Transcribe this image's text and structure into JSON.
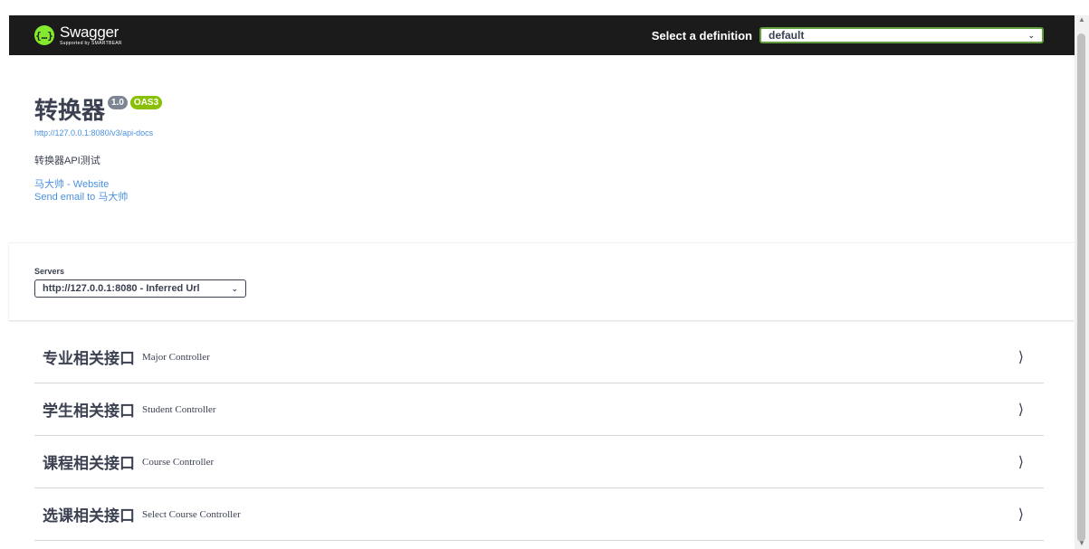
{
  "header": {
    "logo_icon": "{…}",
    "logo_title": "Swagger",
    "logo_subtitle": "Supported by SMARTBEAR",
    "definition_label": "Select a definition",
    "definition_value": "default"
  },
  "info": {
    "title": "转换器",
    "version": "1.0",
    "oas": "OAS3",
    "url": "http://127.0.0.1:8080/v3/api-docs",
    "description": "转换器API测试",
    "website_link": "马大帅 - Website",
    "email_link": "Send email to 马大帅"
  },
  "servers": {
    "label": "Servers",
    "selected": "http://127.0.0.1:8080 - Inferred Url"
  },
  "tags": [
    {
      "name": "专业相关接口",
      "desc": "Major Controller"
    },
    {
      "name": "学生相关接口",
      "desc": "Student Controller"
    },
    {
      "name": "课程相关接口",
      "desc": "Course Controller"
    },
    {
      "name": "选课相关接口",
      "desc": "Select Course Controller"
    }
  ],
  "icons": {
    "chevron": "chevron-down-icon",
    "arrow": "chevron-right-icon"
  },
  "colors": {
    "topbar": "#1b1b1b",
    "accent": "#85ea2d",
    "link": "#4990e2",
    "oas_badge": "#89bf04",
    "version_badge": "#7d8492"
  }
}
